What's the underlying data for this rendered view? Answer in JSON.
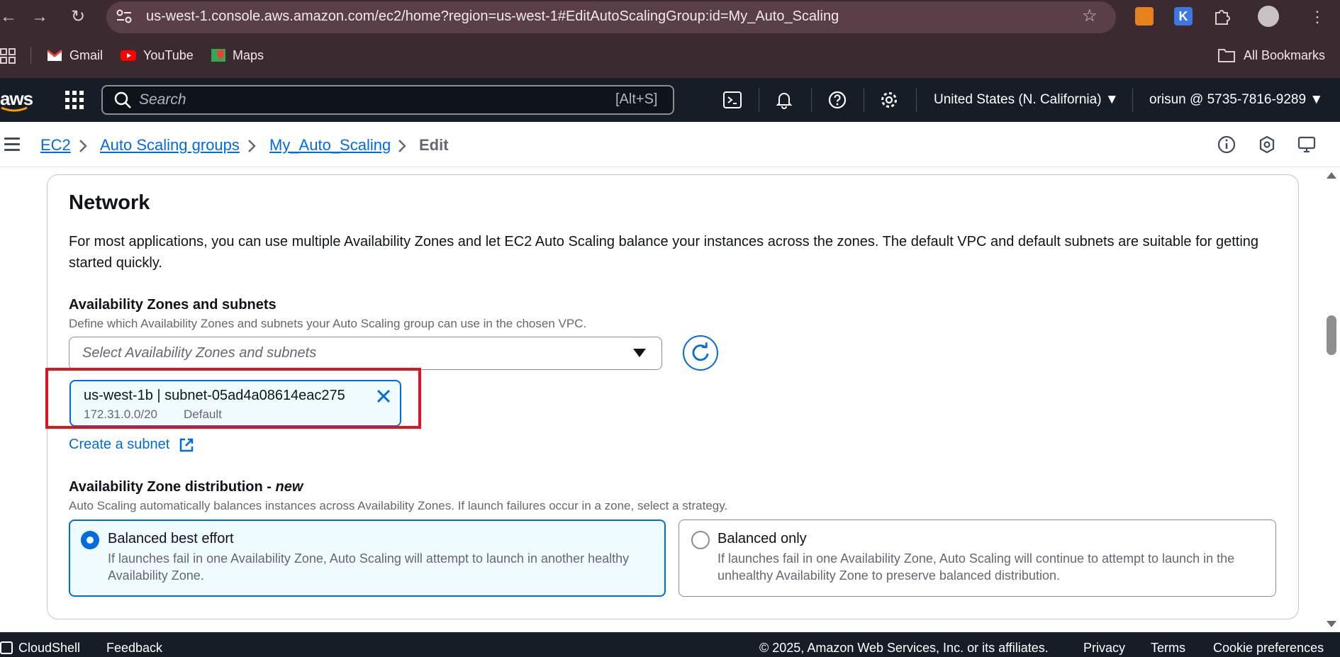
{
  "browser": {
    "url": "us-west-1.console.aws.amazon.com/ec2/home?region=us-west-1#EditAutoScalingGroup:id=My_Auto_Scaling",
    "bookmarks": [
      {
        "label": "Gmail"
      },
      {
        "label": "YouTube"
      },
      {
        "label": "Maps"
      }
    ],
    "all_bookmarks": "All Bookmarks"
  },
  "aws_header": {
    "logo": "aws",
    "search_placeholder": "Search",
    "search_shortcut": "[Alt+S]",
    "region": "United States (N. California) ▼",
    "account": "orisun @ 5735-7816-9289 ▼"
  },
  "breadcrumb": {
    "items": [
      "EC2",
      "Auto Scaling groups",
      "My_Auto_Scaling"
    ],
    "current": "Edit"
  },
  "network": {
    "title": "Network",
    "description": "For most applications, you can use multiple Availability Zones and let EC2 Auto Scaling balance your instances across the zones. The default VPC and default subnets are suitable for getting started quickly.",
    "az_label": "Availability Zones and subnets",
    "az_description": "Define which Availability Zones and subnets your Auto Scaling group can use in the chosen VPC.",
    "select_placeholder": "Select Availability Zones and subnets",
    "selected_subnet": {
      "title": "us-west-1b | subnet-05ad4a08614eac275",
      "cidr": "172.31.0.0/20",
      "tag": "Default"
    },
    "create_subnet": "Create a subnet",
    "distribution_label": "Availability Zone distribution - ",
    "distribution_new": "new",
    "distribution_description": "Auto Scaling automatically balances instances across Availability Zones. If launch failures occur in a zone, select a strategy.",
    "options": [
      {
        "title": "Balanced best effort",
        "description": "If launches fail in one Availability Zone, Auto Scaling will attempt to launch in another healthy Availability Zone.",
        "selected": true
      },
      {
        "title": "Balanced only",
        "description": "If launches fail in one Availability Zone, Auto Scaling will continue to attempt to launch in the unhealthy Availability Zone to preserve balanced distribution.",
        "selected": false
      }
    ]
  },
  "footer": {
    "cloudshell": "CloudShell",
    "feedback": "Feedback",
    "copyright": "© 2025, Amazon Web Services, Inc. or its affiliates.",
    "privacy": "Privacy",
    "terms": "Terms",
    "cookies": "Cookie preferences"
  },
  "colors": {
    "accent": "#006ce0",
    "header_bg": "#161d26",
    "browser_bg": "#3c2a31",
    "highlight": "#e0141e"
  }
}
